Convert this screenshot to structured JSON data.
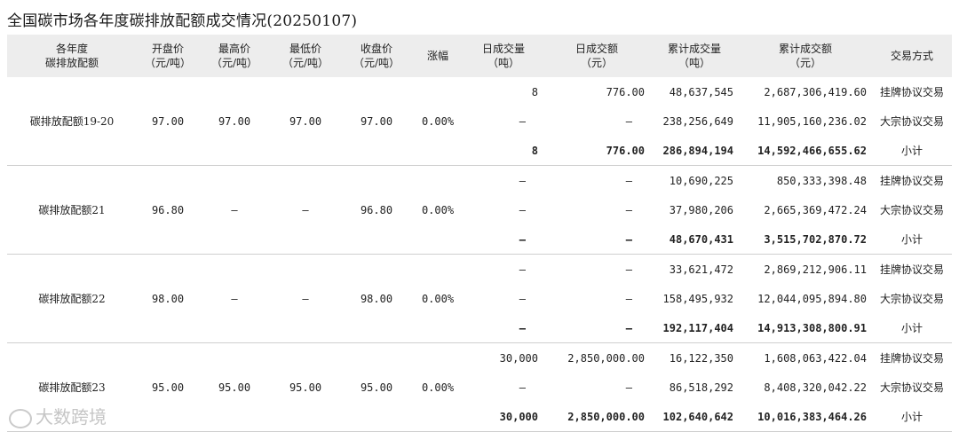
{
  "title": "全国碳市场各年度碳排放配额成交情况(20250107)",
  "headers": [
    [
      "各年度",
      "碳排放配额"
    ],
    [
      "开盘价",
      "（元/吨）"
    ],
    [
      "最高价",
      "（元/吨）"
    ],
    [
      "最低价",
      "（元/吨）"
    ],
    [
      "收盘价",
      "（元/吨）"
    ],
    [
      "涨幅"
    ],
    [
      "日成交量",
      "（吨）"
    ],
    [
      "日成交额",
      "（元）"
    ],
    [
      "累计成交量",
      "（吨）"
    ],
    [
      "累计成交额",
      "（元）"
    ],
    [
      "交易方式"
    ]
  ],
  "groups": [
    {
      "name": "碳排放配额19-20",
      "open": "97.00",
      "high": "97.00",
      "low": "97.00",
      "close": "97.00",
      "change": "0.00%",
      "rows": [
        {
          "dv": "8",
          "da": "776.00",
          "cv": "48,637,545",
          "ca": "2,687,306,419.60",
          "mode": "挂牌协议交易"
        },
        {
          "dv": "–",
          "da": "–",
          "cv": "238,256,649",
          "ca": "11,905,160,236.02",
          "mode": "大宗协议交易"
        },
        {
          "dv": "8",
          "da": "776.00",
          "cv": "286,894,194",
          "ca": "14,592,466,655.62",
          "mode": "小计"
        }
      ]
    },
    {
      "name": "碳排放配额21",
      "open": "96.80",
      "high": "–",
      "low": "–",
      "close": "96.80",
      "change": "0.00%",
      "rows": [
        {
          "dv": "–",
          "da": "–",
          "cv": "10,690,225",
          "ca": "850,333,398.48",
          "mode": "挂牌协议交易"
        },
        {
          "dv": "–",
          "da": "–",
          "cv": "37,980,206",
          "ca": "2,665,369,472.24",
          "mode": "大宗协议交易"
        },
        {
          "dv": "–",
          "da": "–",
          "cv": "48,670,431",
          "ca": "3,515,702,870.72",
          "mode": "小计"
        }
      ]
    },
    {
      "name": "碳排放配额22",
      "open": "98.00",
      "high": "–",
      "low": "–",
      "close": "98.00",
      "change": "0.00%",
      "rows": [
        {
          "dv": "–",
          "da": "–",
          "cv": "33,621,472",
          "ca": "2,869,212,906.11",
          "mode": "挂牌协议交易"
        },
        {
          "dv": "–",
          "da": "–",
          "cv": "158,495,932",
          "ca": "12,044,095,894.80",
          "mode": "大宗协议交易"
        },
        {
          "dv": "–",
          "da": "–",
          "cv": "192,117,404",
          "ca": "14,913,308,800.91",
          "mode": "小计"
        }
      ]
    },
    {
      "name": "碳排放配额23",
      "open": "95.00",
      "high": "95.00",
      "low": "95.00",
      "close": "95.00",
      "change": "0.00%",
      "rows": [
        {
          "dv": "30,000",
          "da": "2,850,000.00",
          "cv": "16,122,350",
          "ca": "1,608,063,422.04",
          "mode": "挂牌协议交易"
        },
        {
          "dv": "–",
          "da": "–",
          "cv": "86,518,292",
          "ca": "8,408,320,042.22",
          "mode": "大宗协议交易"
        },
        {
          "dv": "30,000",
          "da": "2,850,000.00",
          "cv": "102,640,642",
          "ca": "10,016,383,464.26",
          "mode": "小计"
        }
      ]
    }
  ],
  "watermark": "大数跨境"
}
